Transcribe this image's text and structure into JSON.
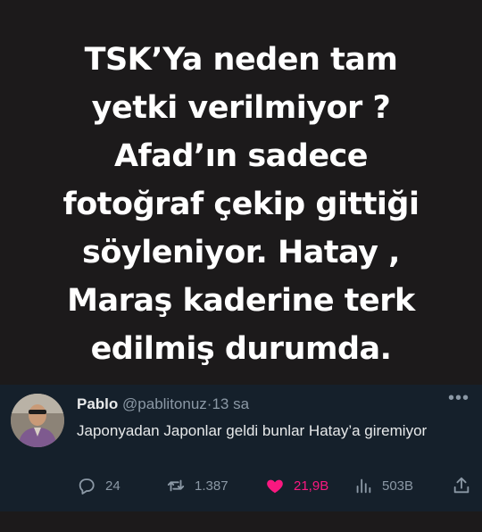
{
  "headline": {
    "lines": [
      "TSK’Ya neden tam",
      "yetki verilmiyor ?",
      "Afad’ın sadece",
      "fotoğraf çekip gittiği",
      "söyleniyor. Hatay ,",
      "Maraş kaderine terk",
      "edilmiş durumda."
    ]
  },
  "tweet": {
    "name": "Pablo",
    "handle": "@pablitonuz",
    "separator": "·",
    "time": "13 sa",
    "text": "Japonyadan Japonlar geldi bunlar Hatay’a giremiyor",
    "more_icon": "more-horizontal-icon",
    "actions": {
      "replies": "24",
      "retweets": "1.387",
      "likes": "21,9B",
      "views": "503B"
    },
    "colors": {
      "card_bg": "#15202b",
      "text": "#e7e9ea",
      "muted": "#8b98a5",
      "like": "#f91880",
      "page_bg": "#1c1a1b"
    }
  }
}
